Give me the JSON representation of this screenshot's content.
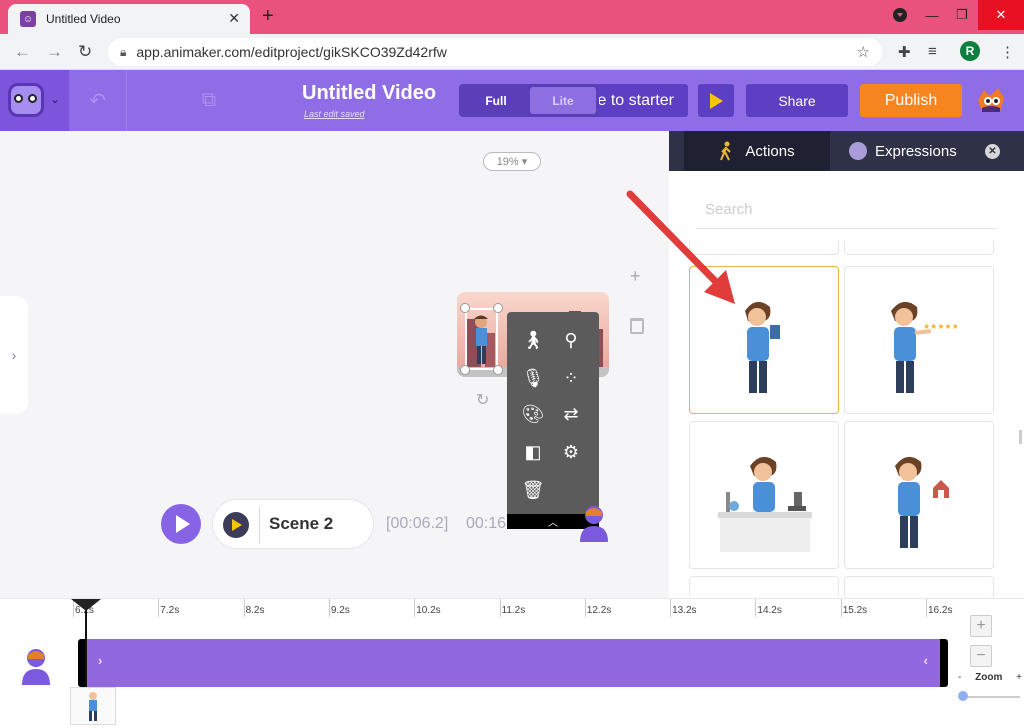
{
  "browser": {
    "tab_title": "Untitled Video",
    "url": "app.animaker.com/editproject/gikSKCO39Zd42rfw",
    "profile_initial": "R"
  },
  "toolbar": {
    "project_title": "Untitled Video",
    "last_saved": "Last edit saved",
    "starter_label": "e to starter",
    "mode_full": "Full",
    "mode_lite": "Lite",
    "share_label": "Share",
    "publish_label": "Publish"
  },
  "canvas": {
    "zoom_level": "19%",
    "scene_label": "Scene 2",
    "timecode": "[00:06.2]",
    "timecode_partial": "00:16"
  },
  "panel": {
    "tab_actions": "Actions",
    "tab_expressions": "Expressions",
    "search_placeholder": "Search"
  },
  "timeline": {
    "ticks": [
      "6.2s",
      "7.2s",
      "8.2s",
      "9.2s",
      "10.2s",
      "11.2s",
      "12.2s",
      "13.2s",
      "14.2s",
      "15.2s",
      "16.2s"
    ],
    "zoom_label": "Zoom",
    "zoom_minus": "-",
    "zoom_plus": "+"
  },
  "colors": {
    "brand_purple": "#8f6de6",
    "publish_orange": "#f6841f",
    "arrow_red": "#e03c3c"
  }
}
